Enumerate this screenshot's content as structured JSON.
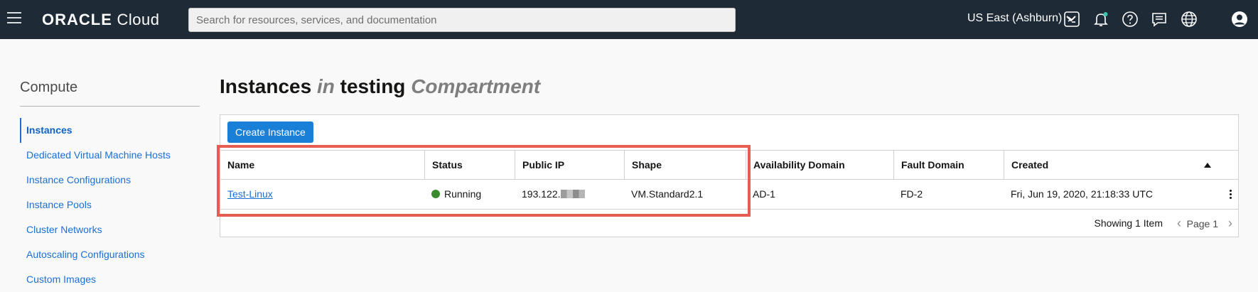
{
  "header": {
    "logo_brand": "ORACLE",
    "logo_product": "Cloud",
    "search_placeholder": "Search for resources, services, and documentation",
    "region": "US East (Ashburn)",
    "icons": [
      "cloud-shell-icon",
      "notification-bell-icon",
      "help-icon",
      "feedback-chat-icon",
      "language-globe-icon",
      "user-profile-icon"
    ]
  },
  "sidebar": {
    "title": "Compute",
    "items": [
      {
        "label": "Instances",
        "active": true
      },
      {
        "label": "Dedicated Virtual Machine Hosts"
      },
      {
        "label": "Instance Configurations"
      },
      {
        "label": "Instance Pools"
      },
      {
        "label": "Cluster Networks"
      },
      {
        "label": "Autoscaling Configurations"
      },
      {
        "label": "Custom Images"
      }
    ]
  },
  "main": {
    "title_prefix": "Instances",
    "title_in": "in",
    "title_compartment": "testing",
    "title_suffix": "Compartment",
    "create_button": "Create Instance",
    "table": {
      "columns": [
        "Name",
        "Status",
        "Public IP",
        "Shape",
        "Availability Domain",
        "Fault Domain",
        "Created"
      ],
      "rows": [
        {
          "name": "Test-Linux",
          "status": "Running",
          "public_ip": "193.122.",
          "shape": "VM.Standard2.1",
          "availability_domain": "AD-1",
          "fault_domain": "FD-2",
          "created": "Fri, Jun 19, 2020, 21:18:33 UTC"
        }
      ]
    },
    "pager": {
      "showing": "Showing 1 Item",
      "page": "Page 1"
    }
  },
  "colors": {
    "topbar": "#1e2a36",
    "link": "#1a6fd6",
    "button": "#1a7fd6",
    "running": "#3a8a2e",
    "highlight": "#e55c50"
  }
}
